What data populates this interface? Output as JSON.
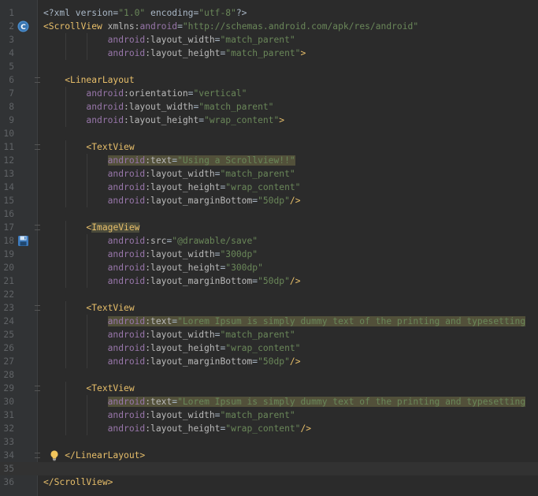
{
  "editor": {
    "language": "xml",
    "lines": [
      {
        "n": "1",
        "indent": 0,
        "tokens": [
          [
            "pl",
            "<?xml version="
          ],
          [
            "st",
            "\"1.0\""
          ],
          [
            "pl",
            " encoding="
          ],
          [
            "st",
            "\"utf-8\""
          ],
          [
            "pl",
            "?>"
          ]
        ]
      },
      {
        "n": "2",
        "indent": 0,
        "gutter_icon": "class-c-icon",
        "tokens": [
          [
            "tg",
            "<ScrollView"
          ],
          [
            "pl",
            " "
          ],
          [
            "at",
            "xmlns:"
          ],
          [
            "tn",
            "android"
          ],
          [
            "pl",
            "="
          ],
          [
            "st",
            "\"http://schemas.android.com/apk/res/android\""
          ]
        ]
      },
      {
        "n": "3",
        "indent": 12,
        "tokens": [
          [
            "tn",
            "android"
          ],
          [
            "at",
            ":layout_width"
          ],
          [
            "pl",
            "="
          ],
          [
            "st",
            "\"match_parent\""
          ]
        ]
      },
      {
        "n": "4",
        "indent": 12,
        "tokens": [
          [
            "tn",
            "android"
          ],
          [
            "at",
            ":layout_height"
          ],
          [
            "pl",
            "="
          ],
          [
            "st",
            "\"match_parent\""
          ],
          [
            "tg",
            ">"
          ]
        ]
      },
      {
        "n": "5",
        "indent": 0,
        "tokens": []
      },
      {
        "n": "6",
        "indent": 4,
        "fold": true,
        "tokens": [
          [
            "tg",
            "<LinearLayout"
          ]
        ]
      },
      {
        "n": "7",
        "indent": 8,
        "tokens": [
          [
            "tn",
            "android"
          ],
          [
            "at",
            ":orientation"
          ],
          [
            "pl",
            "="
          ],
          [
            "st",
            "\"vertical\""
          ]
        ]
      },
      {
        "n": "8",
        "indent": 8,
        "tokens": [
          [
            "tn",
            "android"
          ],
          [
            "at",
            ":layout_width"
          ],
          [
            "pl",
            "="
          ],
          [
            "st",
            "\"match_parent\""
          ]
        ]
      },
      {
        "n": "9",
        "indent": 8,
        "tokens": [
          [
            "tn",
            "android"
          ],
          [
            "at",
            ":layout_height"
          ],
          [
            "pl",
            "="
          ],
          [
            "st",
            "\"wrap_content\""
          ],
          [
            "tg",
            ">"
          ]
        ]
      },
      {
        "n": "10",
        "indent": 0,
        "tokens": []
      },
      {
        "n": "11",
        "indent": 8,
        "fold": true,
        "tokens": [
          [
            "tg",
            "<TextView"
          ]
        ]
      },
      {
        "n": "12",
        "indent": 12,
        "tokens": [
          [
            "tn hl",
            "android"
          ],
          [
            "at hl",
            ":text"
          ],
          [
            "pl hl",
            "="
          ],
          [
            "st hl",
            "\"Using a Scrollview!!\""
          ]
        ]
      },
      {
        "n": "13",
        "indent": 12,
        "tokens": [
          [
            "tn",
            "android"
          ],
          [
            "at",
            ":layout_width"
          ],
          [
            "pl",
            "="
          ],
          [
            "st",
            "\"match_parent\""
          ]
        ]
      },
      {
        "n": "14",
        "indent": 12,
        "tokens": [
          [
            "tn",
            "android"
          ],
          [
            "at",
            ":layout_height"
          ],
          [
            "pl",
            "="
          ],
          [
            "st",
            "\"wrap_content\""
          ]
        ]
      },
      {
        "n": "15",
        "indent": 12,
        "tokens": [
          [
            "tn",
            "android"
          ],
          [
            "at",
            ":layout_marginBottom"
          ],
          [
            "pl",
            "="
          ],
          [
            "st",
            "\"50dp\""
          ],
          [
            "tg",
            "/>"
          ]
        ]
      },
      {
        "n": "16",
        "indent": 0,
        "tokens": []
      },
      {
        "n": "17",
        "indent": 8,
        "fold": true,
        "tokens": [
          [
            "tg",
            "<"
          ],
          [
            "tg hl2",
            "ImageView"
          ]
        ]
      },
      {
        "n": "18",
        "indent": 12,
        "gutter_icon": "save-icon",
        "tokens": [
          [
            "tn",
            "android"
          ],
          [
            "at",
            ":src"
          ],
          [
            "pl",
            "="
          ],
          [
            "st",
            "\"@drawable/save\""
          ]
        ]
      },
      {
        "n": "19",
        "indent": 12,
        "tokens": [
          [
            "tn",
            "android"
          ],
          [
            "at",
            ":layout_width"
          ],
          [
            "pl",
            "="
          ],
          [
            "st",
            "\"300dp\""
          ]
        ]
      },
      {
        "n": "20",
        "indent": 12,
        "tokens": [
          [
            "tn",
            "android"
          ],
          [
            "at",
            ":layout_height"
          ],
          [
            "pl",
            "="
          ],
          [
            "st",
            "\"300dp\""
          ]
        ]
      },
      {
        "n": "21",
        "indent": 12,
        "tokens": [
          [
            "tn",
            "android"
          ],
          [
            "at",
            ":layout_marginBottom"
          ],
          [
            "pl",
            "="
          ],
          [
            "st",
            "\"50dp\""
          ],
          [
            "tg",
            "/>"
          ]
        ]
      },
      {
        "n": "22",
        "indent": 0,
        "tokens": []
      },
      {
        "n": "23",
        "indent": 8,
        "fold": true,
        "tokens": [
          [
            "tg",
            "<TextView"
          ]
        ]
      },
      {
        "n": "24",
        "indent": 12,
        "tokens": [
          [
            "tn hl",
            "android"
          ],
          [
            "at hl",
            ":text"
          ],
          [
            "pl hl",
            "="
          ],
          [
            "st hl",
            "\"Lorem Ipsum is simply dummy text of the printing and typesetting"
          ]
        ]
      },
      {
        "n": "25",
        "indent": 12,
        "tokens": [
          [
            "tn",
            "android"
          ],
          [
            "at",
            ":layout_width"
          ],
          [
            "pl",
            "="
          ],
          [
            "st",
            "\"match_parent\""
          ]
        ]
      },
      {
        "n": "26",
        "indent": 12,
        "tokens": [
          [
            "tn",
            "android"
          ],
          [
            "at",
            ":layout_height"
          ],
          [
            "pl",
            "="
          ],
          [
            "st",
            "\"wrap_content\""
          ]
        ]
      },
      {
        "n": "27",
        "indent": 12,
        "tokens": [
          [
            "tn",
            "android"
          ],
          [
            "at",
            ":layout_marginBottom"
          ],
          [
            "pl",
            "="
          ],
          [
            "st",
            "\"50dp\""
          ],
          [
            "tg",
            "/>"
          ]
        ]
      },
      {
        "n": "28",
        "indent": 0,
        "tokens": []
      },
      {
        "n": "29",
        "indent": 8,
        "fold": true,
        "tokens": [
          [
            "tg",
            "<TextView"
          ]
        ]
      },
      {
        "n": "30",
        "indent": 12,
        "tokens": [
          [
            "tn hl",
            "android"
          ],
          [
            "at hl",
            ":text"
          ],
          [
            "pl hl",
            "="
          ],
          [
            "st hl",
            "\"Lorem Ipsum is simply dummy text of the printing and typesetting"
          ]
        ]
      },
      {
        "n": "31",
        "indent": 12,
        "tokens": [
          [
            "tn",
            "android"
          ],
          [
            "at",
            ":layout_width"
          ],
          [
            "pl",
            "="
          ],
          [
            "st",
            "\"match_parent\""
          ]
        ]
      },
      {
        "n": "32",
        "indent": 12,
        "tokens": [
          [
            "tn",
            "android"
          ],
          [
            "at",
            ":layout_height"
          ],
          [
            "pl",
            "="
          ],
          [
            "st",
            "\"wrap_content\""
          ],
          [
            "tg",
            "/>"
          ]
        ]
      },
      {
        "n": "33",
        "indent": 0,
        "tokens": []
      },
      {
        "n": "34",
        "indent": 4,
        "fold": true,
        "bulb": true,
        "tokens": [
          [
            "tg",
            "</LinearLayout>"
          ]
        ]
      },
      {
        "n": "35",
        "indent": 0,
        "caret": true,
        "tokens": []
      },
      {
        "n": "36",
        "indent": 0,
        "tokens": [
          [
            "tg",
            "</ScrollView>"
          ]
        ]
      }
    ]
  },
  "icons": {
    "class_icon": "class-c-icon",
    "save_icon": "save-icon",
    "bulb_icon": "lightbulb-icon"
  },
  "colors": {
    "background": "#2b2b2b",
    "gutter": "#313335",
    "tag": "#e8bf6a",
    "namespace": "#9876aa",
    "attribute": "#bababa",
    "string": "#6a8759",
    "plain": "#a9b7c6",
    "line_number": "#606366"
  }
}
